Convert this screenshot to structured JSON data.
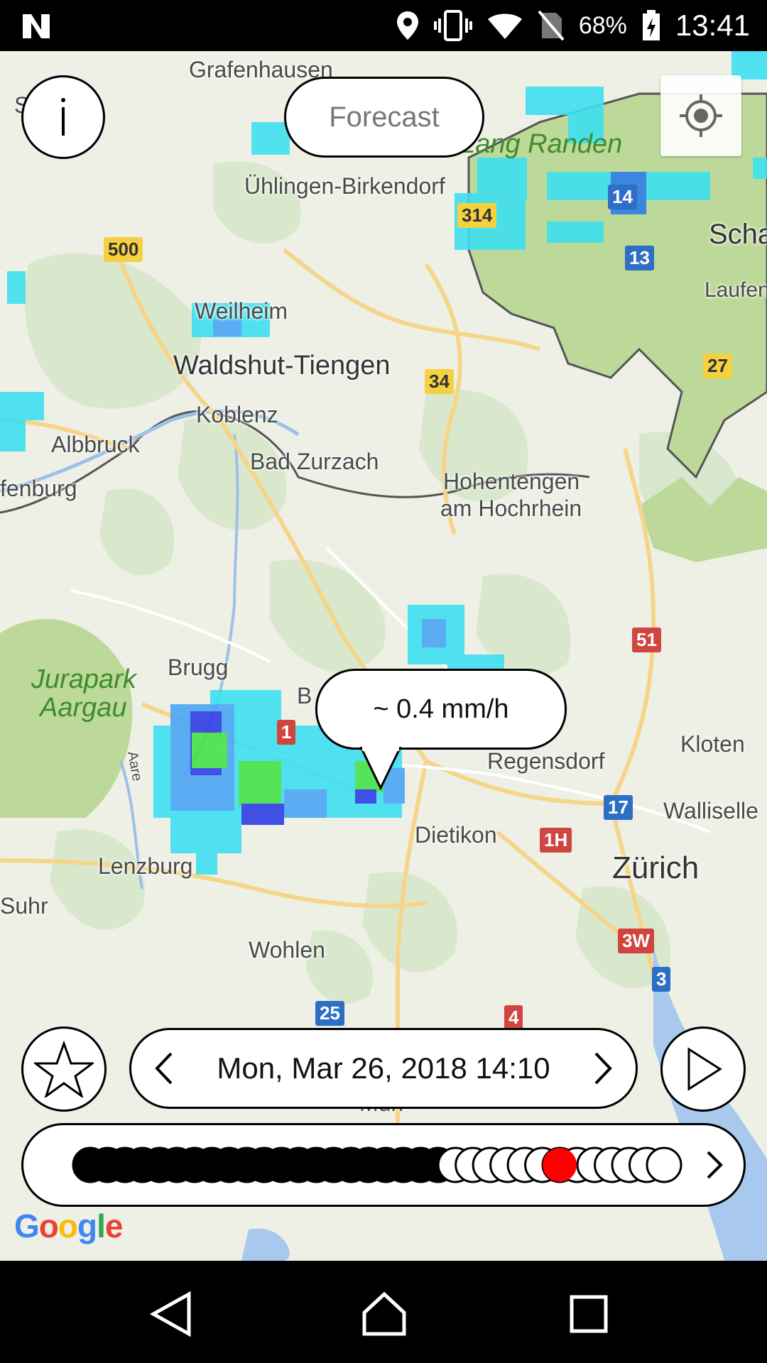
{
  "status_bar": {
    "battery": "68%",
    "time": "13:41",
    "icons": [
      "n-logo-icon",
      "location-icon",
      "vibrate-icon",
      "wifi-icon",
      "no-sim-icon",
      "battery-charging-icon"
    ]
  },
  "buttons": {
    "forecast_label": "Forecast",
    "info_icon": "info-icon",
    "locate_icon": "my-location-icon",
    "favorite_icon": "star-icon",
    "play_icon": "play-icon"
  },
  "tooltip": {
    "text": "~ 0.4 mm/h"
  },
  "date_bar": {
    "prev_icon": "chevron-left-icon",
    "datetime": "Mon, Mar 26, 2018 14:10",
    "next_icon": "chevron-right-icon"
  },
  "timeline": {
    "past_frames": 21,
    "forecast_frames": 13,
    "current_frame_index": 27,
    "next_icon": "chevron-right-icon",
    "colors": {
      "past": "#000000",
      "forecast": "#ffffff",
      "current": "#ff0000"
    }
  },
  "map": {
    "attribution": "Google",
    "labels": {
      "grafenhausen": "Grafenhausen",
      "st_blasien": "S   asien",
      "zang_randen": "Zang Randen",
      "uhlingen": "Ühlingen-Birkendorf",
      "schaffhausen": "Scha",
      "laufen": "Laufen",
      "weilheim": "Weilheim",
      "waldshut": "Waldshut-Tiengen",
      "koblenz": "Koblenz",
      "albbruck": "Albbruck",
      "laufenburg": "fenburg",
      "bad_zurzach": "Bad Zurzach",
      "hohentengen1": "Hohentengen",
      "hohentengen2": "am Hochrhein",
      "jurapark1": "Jurapark",
      "jurapark2": "Aargau",
      "aare": "Aare",
      "brugg": "Brugg",
      "baden": "B",
      "regensdorf": "Regensdorf",
      "kloten": "Kloten",
      "wallisellen": "Walliselle",
      "dietikon": "Dietikon",
      "lenzburg": "Lenzburg",
      "zurich": "Zürich",
      "suhr": "Suhr",
      "wohlen": "Wohlen",
      "muri": "Muri"
    },
    "shields": {
      "s500": "500",
      "s314": "314",
      "s14": "14",
      "s13": "13",
      "s34": "34",
      "s27": "27",
      "s51": "51",
      "s1": "1",
      "s17": "17",
      "s1h": "1H",
      "s3w": "3W",
      "s3": "3",
      "s25": "25",
      "s4": "4"
    }
  },
  "nav_bar": {
    "icons": [
      "back-icon",
      "home-icon",
      "recents-icon"
    ]
  }
}
